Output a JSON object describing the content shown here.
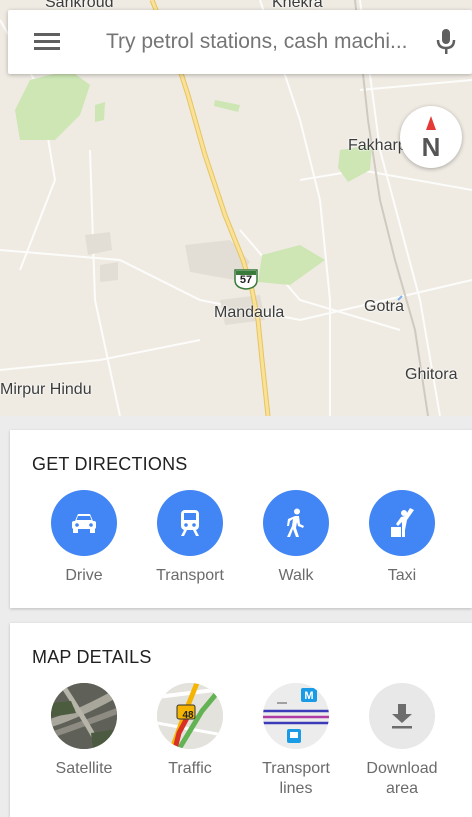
{
  "search": {
    "placeholder": "Try petrol stations, cash machi..."
  },
  "map": {
    "labels": {
      "sankroud": "Sankroud",
      "khekra": "Khekra",
      "fakharpur": "Fakharpur",
      "mandaula": "Mandaula",
      "gotra": "Gotra",
      "mirpur": "Mirpur Hindu",
      "ghitora": "Ghitora",
      "highway": "57"
    },
    "compass_letter": "N",
    "colors": {
      "land": "#efebe3",
      "park": "#cde6b4",
      "highway": "#f6d776",
      "compass_needle": "#e53935"
    }
  },
  "directions": {
    "title": "GET DIRECTIONS",
    "options": [
      {
        "label": "Drive",
        "icon": "car-icon"
      },
      {
        "label": "Transport",
        "icon": "train-icon"
      },
      {
        "label": "Walk",
        "icon": "walk-icon"
      },
      {
        "label": "Taxi",
        "icon": "taxi-icon"
      }
    ],
    "accent": "#4285f4"
  },
  "details": {
    "title": "MAP DETAILS",
    "options": [
      {
        "label": "Satellite",
        "icon": "satellite-thumb"
      },
      {
        "label": "Traffic",
        "icon": "traffic-thumb",
        "badge": "48"
      },
      {
        "label": "Transport lines",
        "icon": "transport-lines-thumb",
        "badge": "M"
      },
      {
        "label": "Download area",
        "icon": "download-icon"
      }
    ]
  }
}
